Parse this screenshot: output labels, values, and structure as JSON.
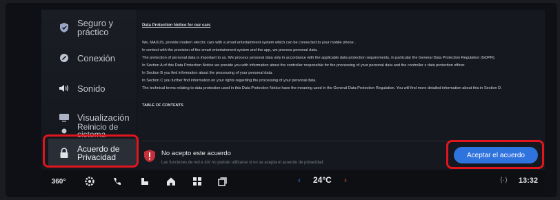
{
  "sidebar": {
    "items": [
      {
        "label": "Seguro y práctico",
        "icon": "shield-icon"
      },
      {
        "label": "Conexión",
        "icon": "link-icon"
      },
      {
        "label": "Sonido",
        "icon": "speaker-icon"
      },
      {
        "label": "Visualización",
        "icon": "display-icon"
      },
      {
        "label": "Reinicio de\nsistema",
        "icon": "reset-icon"
      },
      {
        "label": "Acuerdo de\nPrivacidad",
        "icon": "lock-icon"
      }
    ]
  },
  "document": {
    "title": "Data Protection Notice for our cars",
    "lines": [
      "We, MAXUS, provide modern electric cars with a smart entertainment system which can be connected to your mobile phone .",
      "In context with the provision of the smart entertainment system and the app, we process personal data.",
      "The protection of personal data is important to us. We process personal data only in accordance with the applicable data protection requirements, in particular the General Data Protection Regulation (GDPR).",
      "In Section A of this Data Protection Notice we provide you with information about the controller responsible for the processing of your personal data and the controller s data protection officer.",
      "In Section B you find information about the processing of your personal data.",
      "In Section C you further find information on your rights regarding the processing of your personal data.",
      "The technical terms relating to data protection used in this Data Protection Notice have the meaning used in the General Data Protection Regulation. You will find more detailed information about this in Section D."
    ],
    "toc_heading": "TABLE OF CONTENTS"
  },
  "reject": {
    "title": "No acepto este acuerdo",
    "subtitle": "Las funciones de red e IoV no podrán utilizarse si no se acepta el acuerdo de privacidad."
  },
  "accept_button": "Aceptar el acuerdo",
  "bottombar": {
    "view_360": "360°",
    "temperature": "24°C",
    "time": "13:32",
    "left_arrow": "‹",
    "right_arrow": "›",
    "signal": "⟨·⟩"
  },
  "colors": {
    "accent_blue": "#2f73df",
    "highlight_red": "#e0151e"
  }
}
